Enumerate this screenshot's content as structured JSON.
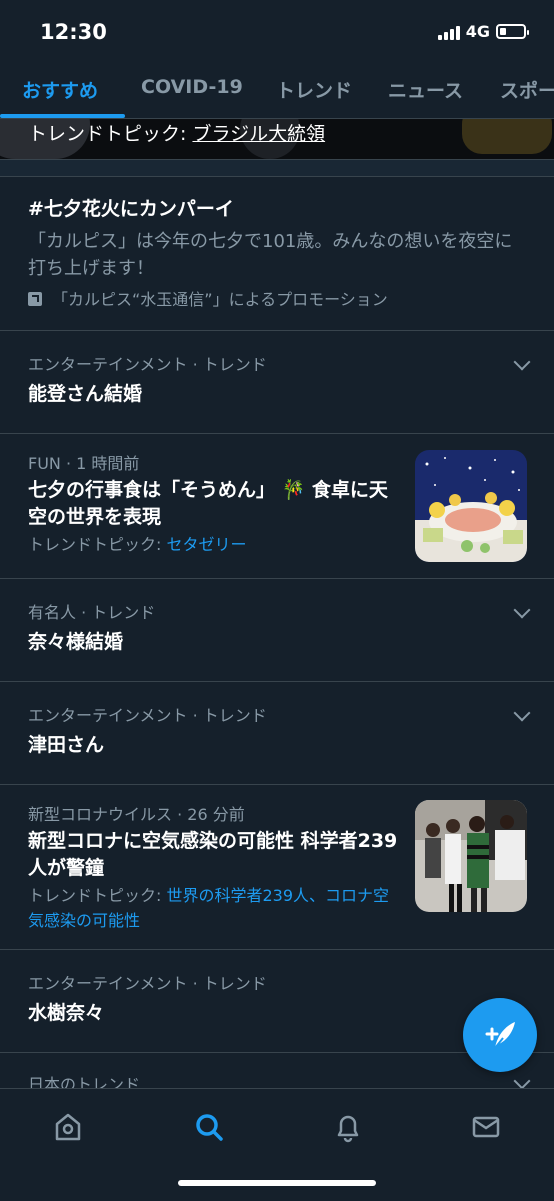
{
  "status": {
    "time": "12:30",
    "network": "4G"
  },
  "tabs": [
    "おすすめ",
    "COVID-19",
    "トレンド",
    "ニュース",
    "スポー"
  ],
  "banner": {
    "prefix": "トレンドトピック: ",
    "topic": "ブラジル大統領"
  },
  "promo": {
    "title": "#七夕花火にカンパーイ",
    "desc": "「カルピス」は今年の七夕で101歳。みんなの想いを夜空に打ち上げます！",
    "promoted_by": "「カルピス“水玉通信”」によるプロモーション"
  },
  "trends": [
    {
      "meta": "エンターテインメント · トレンド",
      "title": "能登さん結婚"
    },
    {
      "meta": "FUN · 1 時間前",
      "title": "七夕の行事食は「そうめん」 🎋 食卓に天空の世界を表現",
      "topic_prefix": "トレンドトピック: ",
      "topic_link": "セタゼリー"
    },
    {
      "meta": "有名人 · トレンド",
      "title": "奈々様結婚"
    },
    {
      "meta": "エンターテインメント · トレンド",
      "title": "津田さん"
    },
    {
      "meta": "新型コロナウイルス · 26 分前",
      "title": "新型コロナに空気感染の可能性 科学者239人が警鐘",
      "topic_prefix": "トレンドトピック: ",
      "topic_link": "世界の科学者239人、コロナ空気感染の可能性"
    },
    {
      "meta": "エンターテインメント · トレンド",
      "title": "水樹奈々"
    },
    {
      "meta": "日本のトレンド"
    }
  ],
  "icons": {
    "home": "home-icon",
    "search": "search-icon",
    "notifications": "bell-icon",
    "messages": "mail-icon",
    "compose": "compose-tweet-icon"
  },
  "colors": {
    "accent": "#1d9bf0",
    "background": "#15202b",
    "muted": "#8899a6"
  }
}
